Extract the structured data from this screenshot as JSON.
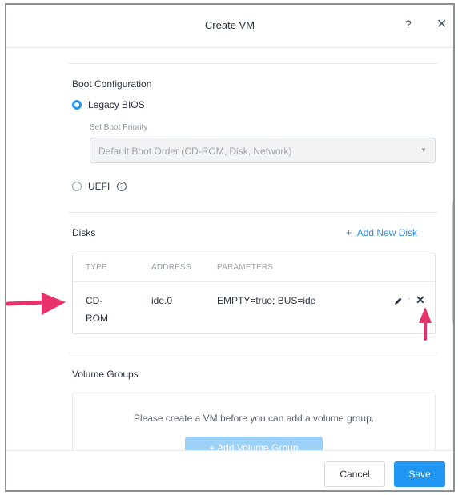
{
  "dialog": {
    "title": "Create VM",
    "help_glyph": "?",
    "close_glyph": "✕"
  },
  "boot": {
    "section_title": "Boot Configuration",
    "legacy_label": "Legacy BIOS",
    "legacy_selected": true,
    "priority_label": "Set Boot Priority",
    "priority_value": "Default Boot Order (CD-ROM, Disk, Network)",
    "uefi_label": "UEFI",
    "uefi_selected": false
  },
  "disks": {
    "section_title": "Disks",
    "add_label": "Add New Disk",
    "columns": [
      "TYPE",
      "ADDRESS",
      "PARAMETERS"
    ],
    "rows": [
      {
        "type_line1": "CD-",
        "type_line2": "ROM",
        "address": "ide.0",
        "parameters": "EMPTY=true; BUS=ide"
      }
    ],
    "row_separator": "·",
    "remove_glyph": "✕"
  },
  "volume_groups": {
    "section_title": "Volume Groups",
    "message": "Please create a VM before you can add a volume group.",
    "add_label": "+ Add Volume Group"
  },
  "footer": {
    "cancel_label": "Cancel",
    "save_label": "Save"
  },
  "icons": {
    "help": "question-icon",
    "close": "close-icon",
    "info": "info-icon",
    "edit": "pencil-icon",
    "remove": "close-icon",
    "select": "chevron-down-icon"
  },
  "colors": {
    "accent": "#2196f3",
    "link": "#2a8ee8",
    "annotation_arrow": "#e8326b"
  }
}
